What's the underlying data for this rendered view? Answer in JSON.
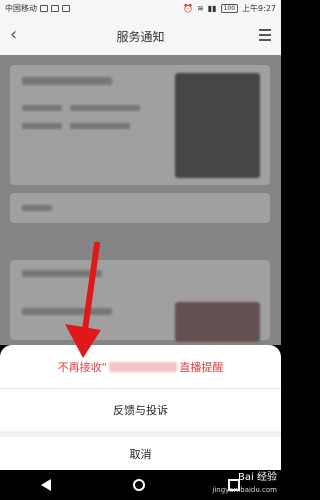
{
  "status_bar": {
    "carrier": "中国移动",
    "battery": "100",
    "time": "上午9:27"
  },
  "header": {
    "title": "服务通知",
    "back_icon": "chevron-left-icon",
    "menu_icon": "hamburger-menu-icon"
  },
  "action_sheet": {
    "unsubscribe_prefix": "不再接收“",
    "unsubscribe_suffix": "直播提醒",
    "feedback_label": "反馈与投诉",
    "cancel_label": "取消",
    "accent_color": "#e04040"
  },
  "watermark": {
    "brand": "Bai 经验",
    "url": "jingyan.baidu.com"
  },
  "annotation": {
    "arrow_color": "#e01818"
  }
}
